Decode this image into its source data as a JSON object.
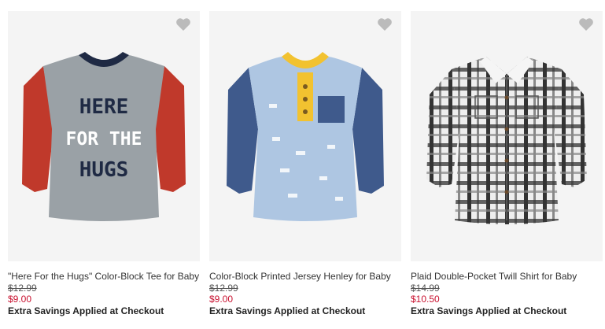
{
  "products": [
    {
      "name": "\"Here For the Hugs\" Color-Block Tee for Baby",
      "old_price": "$12.99",
      "new_price": "$9.00",
      "promo": "Extra Savings Applied at Checkout",
      "graphic_text": [
        "HERE",
        "FOR THE",
        "HUGS"
      ]
    },
    {
      "name": "Color-Block Printed Jersey Henley for Baby",
      "old_price": "$12.99",
      "new_price": "$9.00",
      "promo": "Extra Savings Applied at Checkout"
    },
    {
      "name": "Plaid Double-Pocket Twill Shirt for Baby",
      "old_price": "$14.99",
      "new_price": "$10.50",
      "promo": "Extra Savings Applied at Checkout"
    }
  ],
  "colors": {
    "sale_price": "#c8102e",
    "image_bg": "#f4f4f4",
    "heart": "#bbbbbb"
  },
  "icons": {
    "favorite": "heart-icon"
  }
}
